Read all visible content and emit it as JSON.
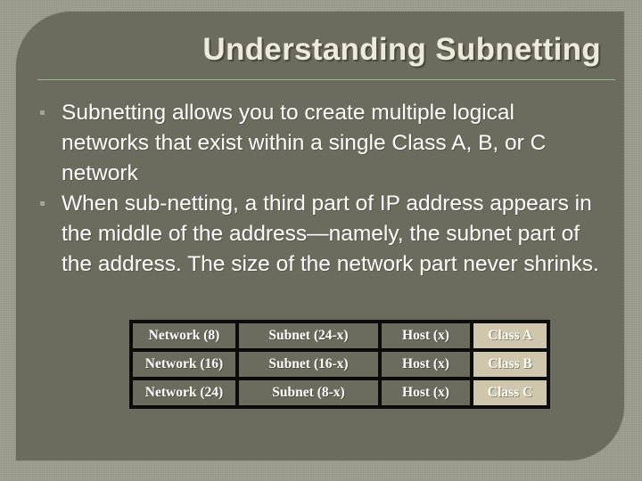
{
  "slide": {
    "title": "Understanding Subnetting",
    "colors": {
      "outer_frame": "#9b9c8a",
      "inner_panel": "#6c6c5e",
      "title_text": "#ebeadb",
      "rule": "#9db395",
      "body_text": "#ffffff",
      "table_cell_bg": "#6c6c5e",
      "table_class_cell_bg": "#cec6ad",
      "table_border": "#0b0b0b"
    },
    "bullets": [
      {
        "marker": "square-bullet",
        "text": "Subnetting allows you to create multiple logical networks that exist within a single Class A, B, or C network"
      },
      {
        "marker": "square-bullet",
        "text": "When sub-netting, a third part of IP address appears in the middle of the address—namely, the subnet part of the address. The size of the network part never shrinks."
      }
    ],
    "table": {
      "rows": [
        {
          "network": "Network (8)",
          "subnet": "Subnet (24-x)",
          "host": "Host (x)",
          "class": "Class A"
        },
        {
          "network": "Network (16)",
          "subnet": "Subnet (16-x)",
          "host": "Host (x)",
          "class": "Class B"
        },
        {
          "network": "Network (24)",
          "subnet": "Subnet (8-x)",
          "host": "Host (x)",
          "class": "Class C"
        }
      ]
    }
  }
}
